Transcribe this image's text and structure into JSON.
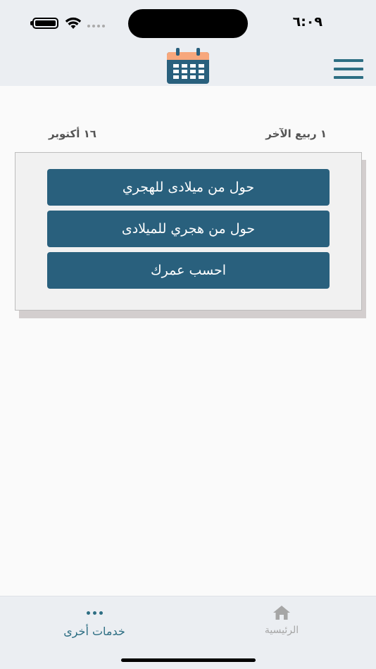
{
  "status_bar": {
    "time": "٦:٠٩"
  },
  "header": {
    "logo_icon": "calendar-icon",
    "menu_icon": "hamburger-menu-icon"
  },
  "dates": {
    "hijri": "١ ربيع الآخر",
    "gregorian": "١٦ أكتوبر"
  },
  "actions": [
    {
      "label": "حول من ميلادى للهجري"
    },
    {
      "label": "حول من هجري للميلادى"
    },
    {
      "label": "احسب عمرك"
    }
  ],
  "tabs": {
    "home": {
      "label": "الرئيسية",
      "icon": "home-icon"
    },
    "more": {
      "label": "خدمات أخرى",
      "icon": "more-dots-icon"
    }
  },
  "colors": {
    "accent": "#29607d",
    "logo_top": "#f7a77c"
  }
}
